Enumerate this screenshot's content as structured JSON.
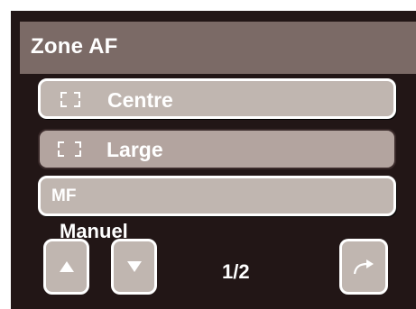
{
  "header": {
    "title": "Zone AF"
  },
  "options": [
    {
      "label": "Centre",
      "icon": "af-frame-icon",
      "selected": false
    },
    {
      "label": "Large",
      "icon": "af-frame-wide-icon",
      "selected": true
    },
    {
      "label": "MF",
      "icon": null,
      "selected": false,
      "sublabel": "Manuel"
    }
  ],
  "pagination": {
    "indicator": "1/2"
  },
  "icons": {
    "up": "arrow-up-icon",
    "down": "arrow-down-icon",
    "return": "return-arrow-icon"
  },
  "colors": {
    "background": "#221616",
    "header": "#7b6a66",
    "option": "#c0b6b0",
    "option_selected": "#b3a49f",
    "text": "#ffffff"
  }
}
